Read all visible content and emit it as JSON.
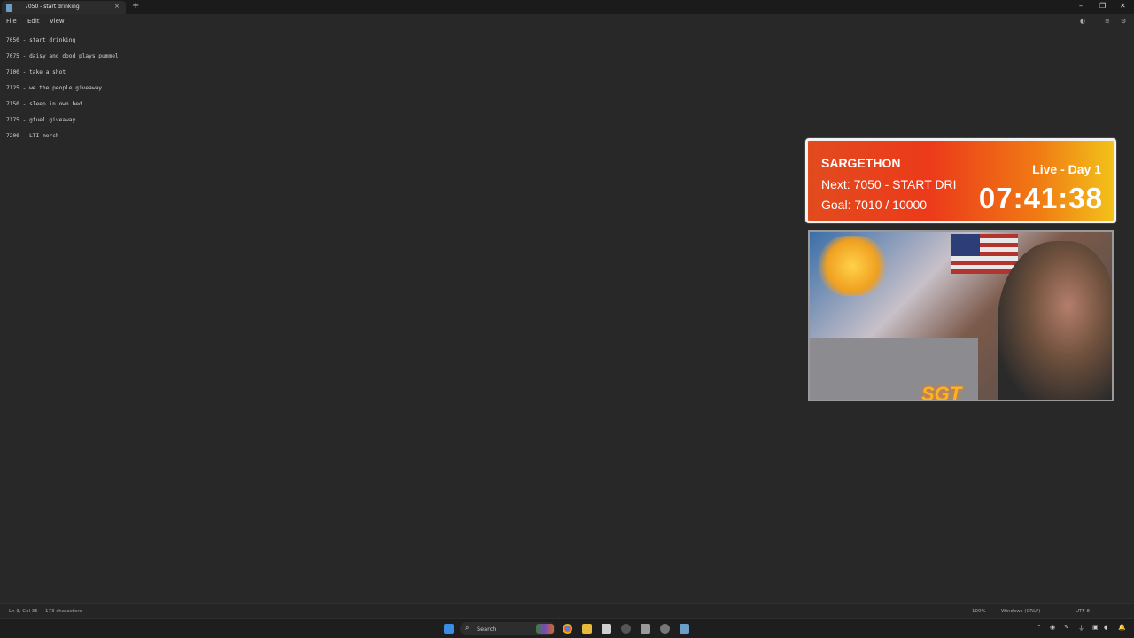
{
  "window": {
    "tab_title": "7050 - start drinking",
    "close_glyph": "×",
    "new_tab_glyph": "+",
    "controls": {
      "minimize": "–",
      "maximize": "❐",
      "close": "✕"
    }
  },
  "menu": {
    "items": [
      "File",
      "Edit",
      "View"
    ]
  },
  "editor": {
    "lines": [
      "7050 - start drinking",
      "7075 - daisy and dood plays pummel",
      "7100 - take a shot",
      "7125 - we the people giveaway",
      "7150 - sleep in own bed",
      "7175 - gfuel giveaway",
      "7200 - LTI merch"
    ]
  },
  "status": {
    "position": "Ln 3, Col 35",
    "characters": "173 characters",
    "zoom": "100%",
    "line_ending": "Windows (CRLF)",
    "encoding": "UTF-8"
  },
  "taskbar": {
    "search_label": "Search"
  },
  "overlay": {
    "title": "SARGETHON",
    "next": "Next: 7050 - START DRI",
    "goal": "Goal: 7010 / 10000",
    "live": "Live - Day 1",
    "timer": "07:41:38"
  },
  "webcam": {
    "logo": "SGT"
  }
}
